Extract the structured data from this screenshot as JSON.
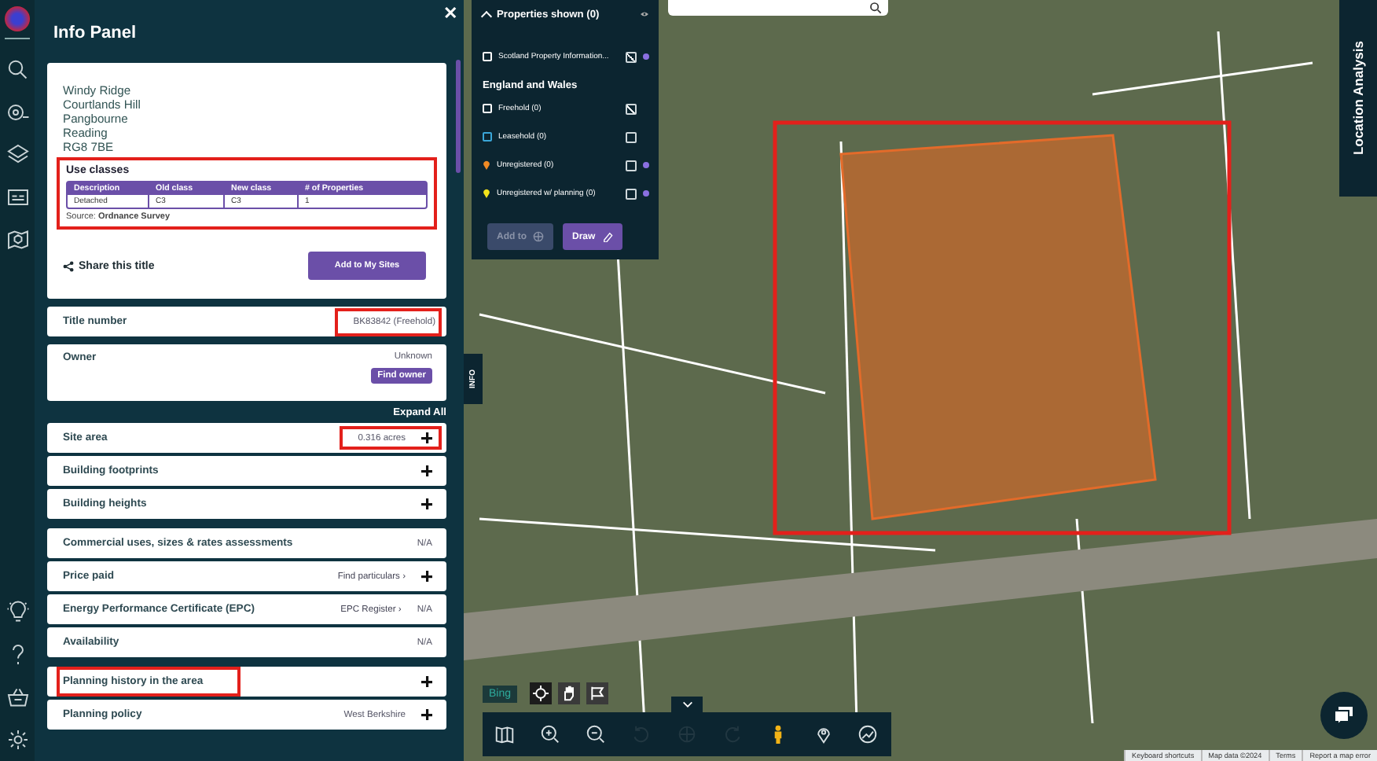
{
  "panel": {
    "title": "Info Panel",
    "close": "✕",
    "address": [
      "Windy Ridge",
      "Courtlands Hill",
      "Pangbourne",
      "Reading",
      "RG8 7BE"
    ],
    "use_classes": {
      "title": "Use classes",
      "highlighted": true,
      "columns": [
        "Description",
        "Old class",
        "New class",
        "# of Properties"
      ],
      "rows": [
        [
          "Detached",
          "C3",
          "C3",
          "1"
        ]
      ],
      "source_label": "Source:",
      "source": "Ordnance Survey"
    },
    "share": "Share this title",
    "add_button": "Add to My Sites",
    "title_number": {
      "label": "Title number",
      "value": "BK83842 (Freehold)",
      "highlighted": true
    },
    "owner": {
      "label": "Owner",
      "value": "Unknown",
      "button": "Find owner"
    },
    "expand_all": "Expand All",
    "groups": [
      [
        {
          "label": "Site area",
          "value": "0.316 acres",
          "expandable": true,
          "highlighted": true
        },
        {
          "label": "Building footprints",
          "expandable": true,
          "highlighted": false
        },
        {
          "label": "Building heights",
          "expandable": true,
          "highlighted": false
        }
      ],
      [
        {
          "label": "Commercial uses, sizes & rates assessments",
          "value": "N/A",
          "expandable": false,
          "highlighted": false
        },
        {
          "label": "Price paid",
          "link": "Find particulars ›",
          "expandable": true,
          "highlighted": false
        },
        {
          "label": "Energy Performance Certificate (EPC)",
          "link": "EPC Register ›",
          "value": "N/A",
          "expandable": false,
          "highlighted": false
        },
        {
          "label": "Availability",
          "value": "N/A",
          "expandable": false,
          "highlighted": false
        }
      ],
      [
        {
          "label": "Planning history in the area",
          "expandable": true,
          "highlighted": true
        },
        {
          "label": "Planning policy",
          "value": "West Berkshire",
          "expandable": true,
          "highlighted": false
        }
      ]
    ]
  },
  "properties": {
    "title": "Properties shown (0)",
    "expanded": true,
    "items": [
      {
        "kind": "square",
        "label": "Scotland Property Information...",
        "color": "#ffffff",
        "checked": true,
        "dot": true
      },
      {
        "kind": "heading",
        "label": "England and Wales"
      },
      {
        "kind": "square",
        "label": "Freehold (0)",
        "color": "#ffffff",
        "checked": true,
        "dot": false
      },
      {
        "kind": "square",
        "label": "Leasehold (0)",
        "color": "#3aa6d8",
        "checked": false,
        "dot": false
      },
      {
        "kind": "pin",
        "label": "Unregistered (0)",
        "color": "#f08a24",
        "checked": false,
        "dot": true
      },
      {
        "kind": "pin",
        "label": "Unregistered w/ planning (0)",
        "color": "#f2e21a",
        "checked": false,
        "dot": true
      }
    ],
    "buttons": [
      {
        "label": "Add to",
        "disabled": true
      },
      {
        "label": "Draw",
        "disabled": false
      }
    ]
  },
  "info_tab": "INFO",
  "location_tab": "Location Analysis",
  "map_tools": [
    {
      "selected": true
    },
    {
      "selected": false
    },
    {
      "selected": false
    }
  ],
  "bing": "Bing",
  "toolbar": [
    {
      "disabled": false
    },
    {
      "disabled": false
    },
    {
      "disabled": false
    },
    {
      "disabled": true
    },
    {
      "disabled": true
    },
    {
      "disabled": true
    },
    {
      "disabled": false
    },
    {
      "disabled": false
    },
    {
      "disabled": false
    }
  ],
  "attribution": [
    "Keyboard shortcuts",
    "Map data ©2024",
    "Terms",
    "Report a map error"
  ]
}
